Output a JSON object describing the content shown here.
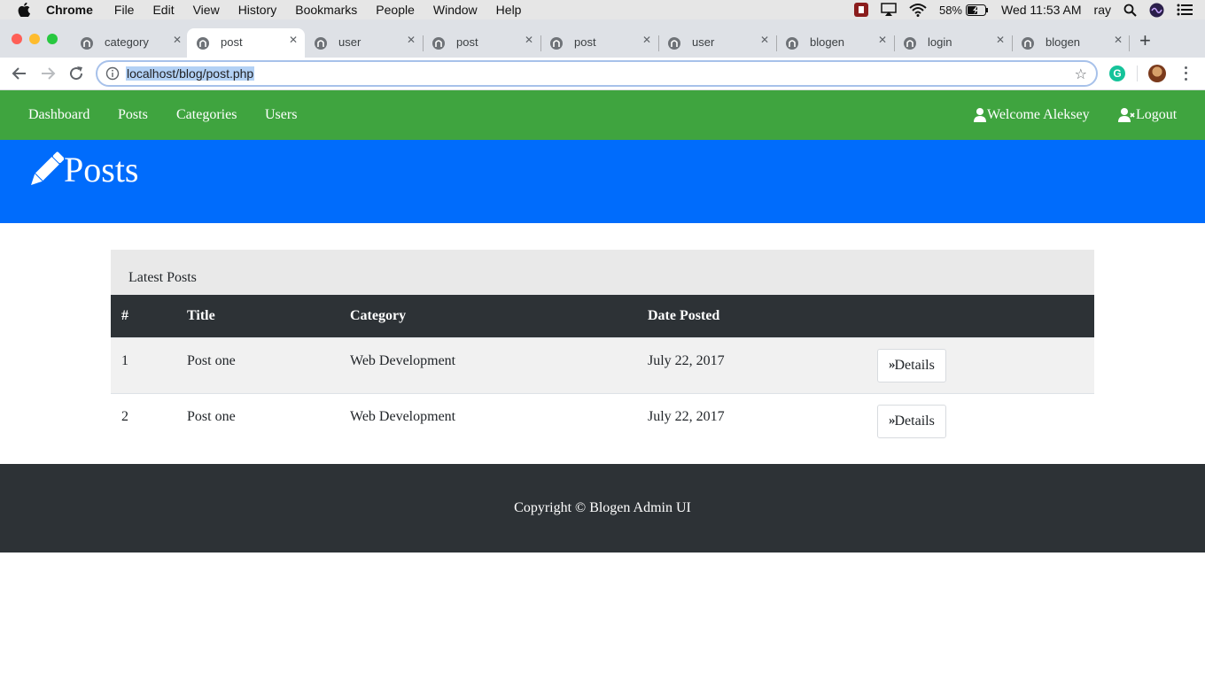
{
  "menubar": {
    "app_name": "Chrome",
    "items": [
      "File",
      "Edit",
      "View",
      "History",
      "Bookmarks",
      "People",
      "Window",
      "Help"
    ],
    "battery": "58%",
    "clock": "Wed 11:53 AM",
    "user": "ray"
  },
  "tabs": [
    {
      "label": "category",
      "active": false
    },
    {
      "label": "post",
      "active": true
    },
    {
      "label": "user",
      "active": false
    },
    {
      "label": "post",
      "active": false
    },
    {
      "label": "post",
      "active": false
    },
    {
      "label": "user",
      "active": false
    },
    {
      "label": "blogen",
      "active": false
    },
    {
      "label": "login",
      "active": false
    },
    {
      "label": "blogen",
      "active": false
    }
  ],
  "address_bar": {
    "url": "localhost/blog/post.php"
  },
  "site_nav": {
    "links": [
      "Dashboard",
      "Posts",
      "Categories",
      "Users"
    ],
    "welcome": "Welcome Aleksey",
    "logout": "Logout"
  },
  "header": {
    "title": "Posts"
  },
  "posts_card": {
    "heading": "Latest Posts",
    "columns": [
      "#",
      "Title",
      "Category",
      "Date Posted",
      ""
    ],
    "rows": [
      {
        "num": "1",
        "title": "Post one",
        "category": "Web Development",
        "date": "July 22, 2017",
        "action": "Details"
      },
      {
        "num": "2",
        "title": "Post one",
        "category": "Web Development",
        "date": "July 22, 2017",
        "action": "Details"
      }
    ]
  },
  "footer": {
    "text": "Copyright © Blogen Admin UI"
  },
  "colors": {
    "nav_green": "#3fa43f",
    "header_blue": "#006cfc",
    "dark": "#2d3236"
  }
}
